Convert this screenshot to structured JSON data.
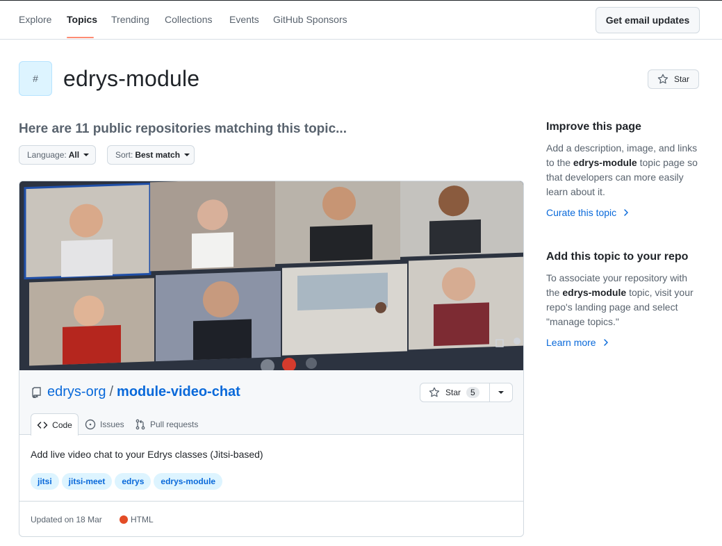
{
  "nav": {
    "items": [
      "Explore",
      "Topics",
      "Trending",
      "Collections",
      "Events",
      "GitHub Sponsors"
    ],
    "active": "Topics",
    "email_button": "Get email updates"
  },
  "topic": {
    "badge_symbol": "#",
    "title": "edrys-module",
    "star_label": "Star"
  },
  "results": {
    "heading": "Here are 11 public repositories matching this topic...",
    "language_label": "Language:",
    "language_value": "All",
    "sort_label": "Sort:",
    "sort_value": "Best match"
  },
  "repo": {
    "image_alt": "video chat grid of participants",
    "owner": "edrys-org",
    "separator": "/",
    "name": "module-video-chat",
    "star_label": "Star",
    "star_count": "5",
    "tabs": [
      "Code",
      "Issues",
      "Pull requests"
    ],
    "active_tab": "Code",
    "description": "Add live video chat to your Edrys classes (Jitsi-based)",
    "tags": [
      "jitsi",
      "jitsi-meet",
      "edrys",
      "edrys-module"
    ],
    "updated": "Updated on 18 Mar",
    "language": "HTML",
    "language_color": "#e34c26"
  },
  "sidebar": {
    "improve_heading": "Improve this page",
    "improve_pre": "Add a description, image, and links to the",
    "improve_topic": "edrys-module",
    "improve_post": "topic page so that developers can more easily learn about it.",
    "curate_link": "Curate this topic",
    "add_heading": "Add this topic to your repo",
    "add_pre": "To associate your repository with the",
    "add_topic": "edrys-module",
    "add_post": "topic, visit your repo's landing page and select \"manage topics.\"",
    "learn_link": "Learn more"
  },
  "colors": {
    "link": "#0969da",
    "tab_underline": "#fd8c73",
    "tag_bg": "#ddf4ff"
  }
}
